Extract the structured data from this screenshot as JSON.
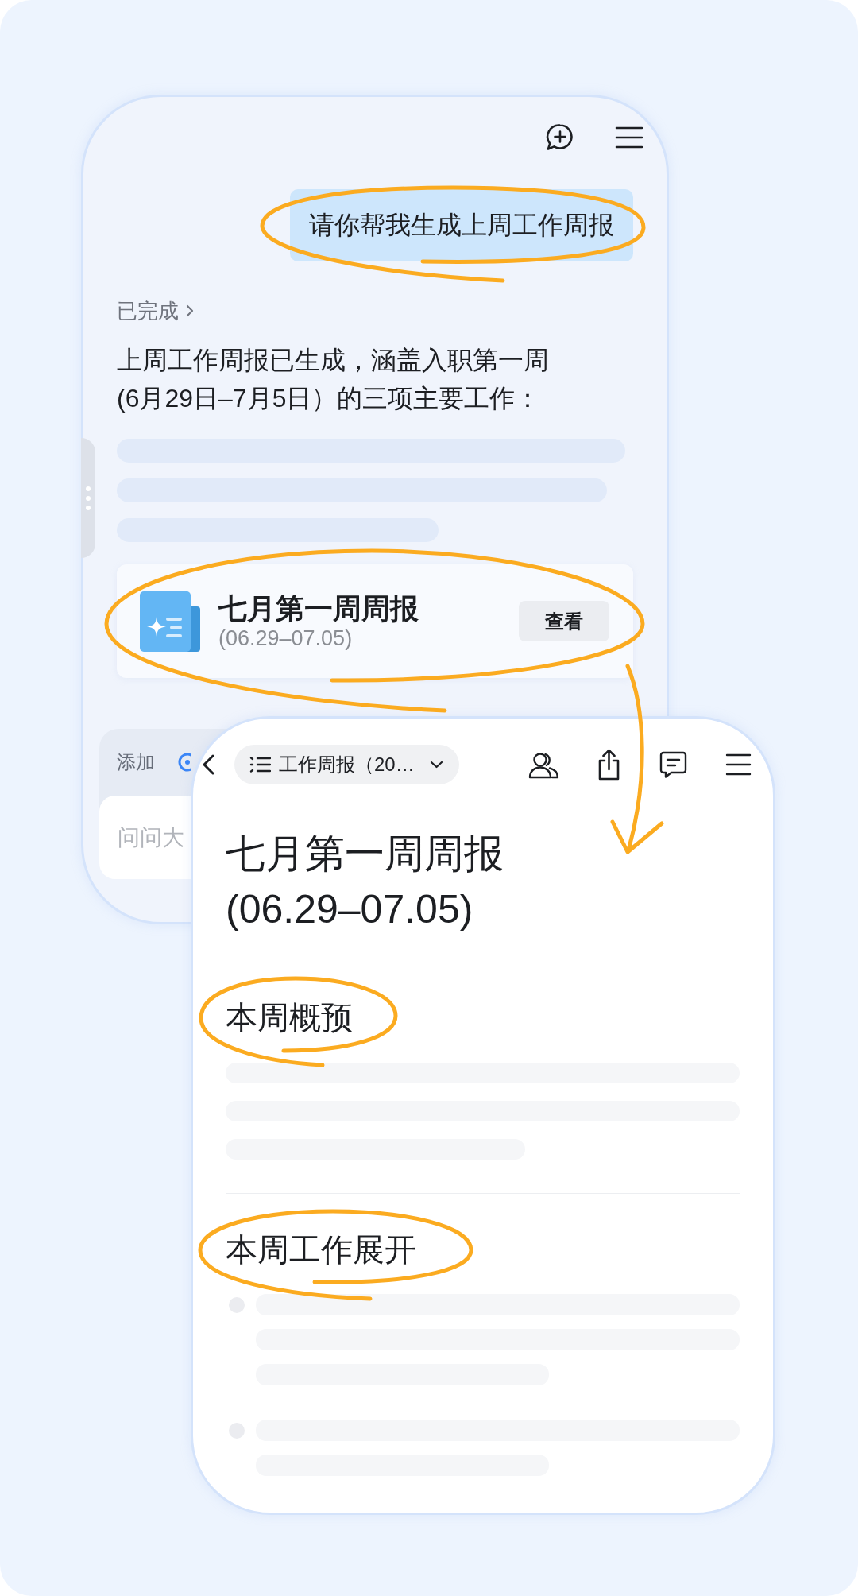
{
  "chat_panel": {
    "user_message": {
      "text": "请你帮我生成上周工作周报",
      "circled": true
    },
    "status": "已完成",
    "reply": "上周工作周报已生成，涵盖入职第一周(6月29日–7月5日）的三项主要工作：",
    "document_card": {
      "title": "七月第一周周报",
      "date_range": "(06.29–07.05)",
      "button": "查看",
      "circled": true
    },
    "composer": {
      "add_label": "添加",
      "placeholder": "问问大"
    }
  },
  "document_panel": {
    "breadcrumb": "工作周报（20…",
    "title": "七月第一周周报(06.29–07.05)",
    "sections": [
      {
        "heading": "本周概预",
        "kind": "summary",
        "circled": true
      },
      {
        "heading": "本周工作展开",
        "kind": "list",
        "circled": true
      }
    ]
  }
}
